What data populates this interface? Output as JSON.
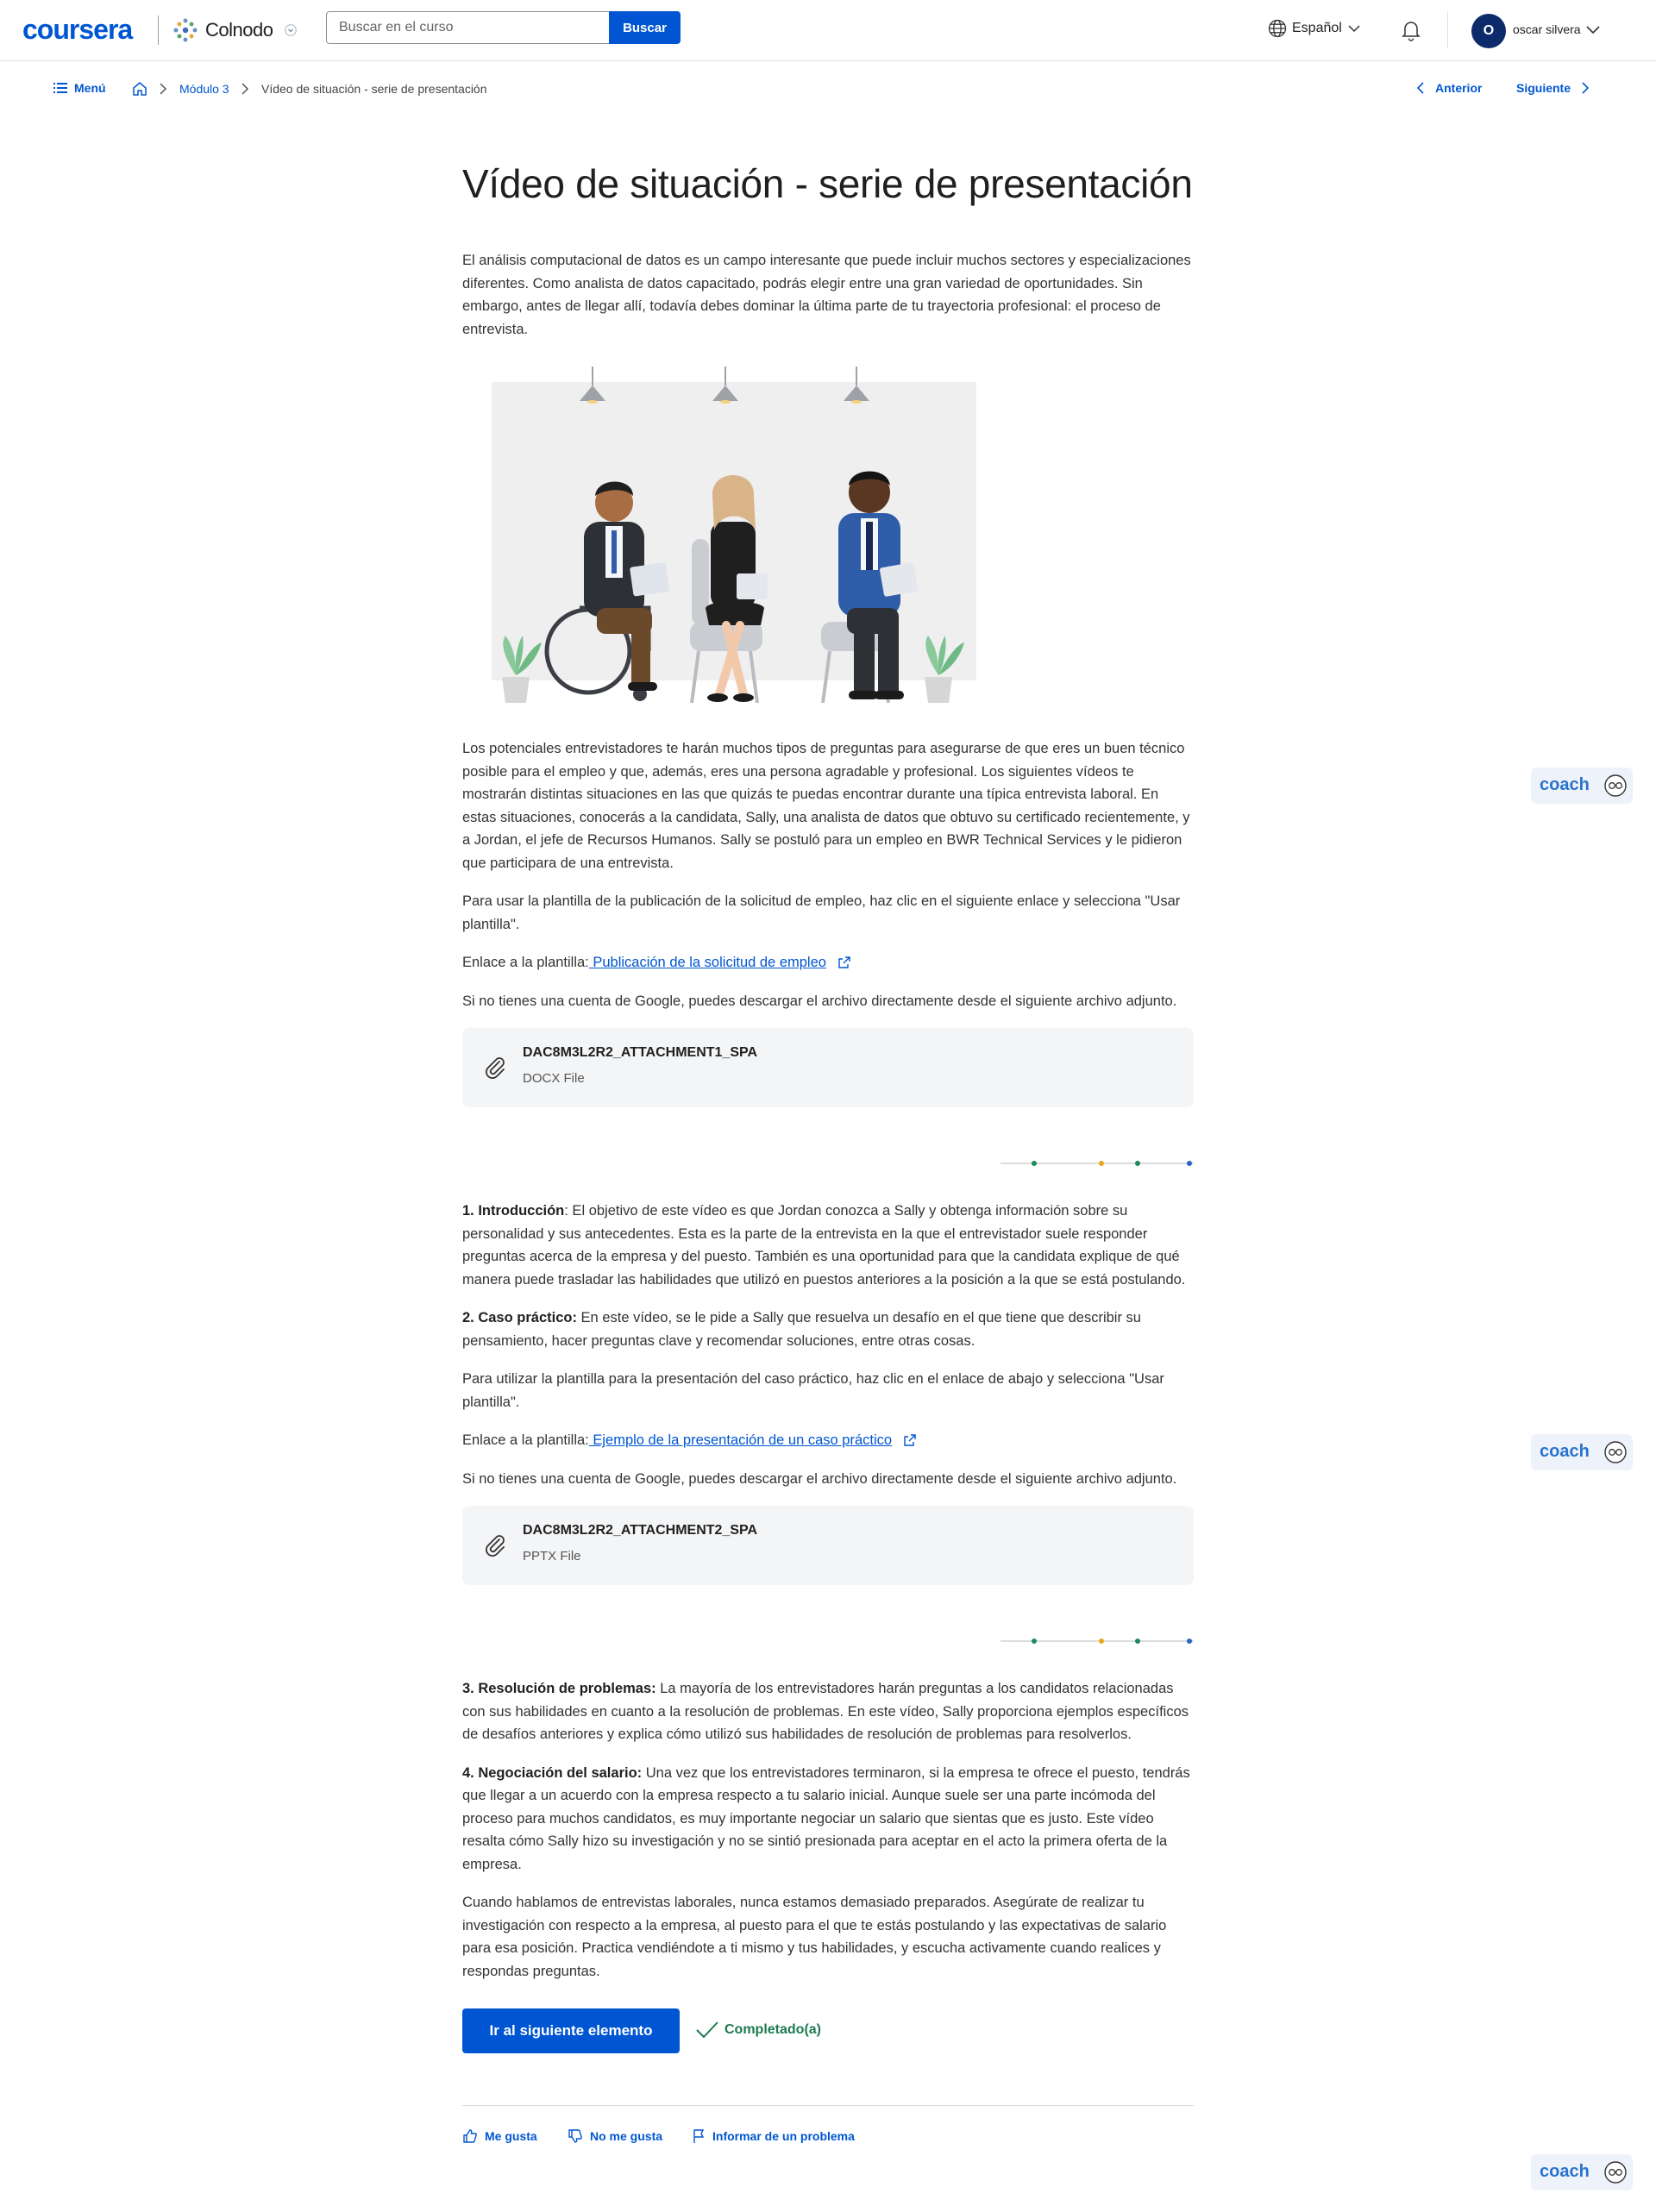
{
  "header": {
    "brand": "coursera",
    "partner": "Colnodo",
    "search_placeholder": "Buscar en el curso",
    "search_button": "Buscar",
    "language": "Español",
    "user_initial": "O",
    "user_name": "oscar silvera"
  },
  "subnav": {
    "menu": "Menú",
    "breadcrumb_module": "Módulo 3",
    "breadcrumb_current": "Vídeo de situación - serie de presentación",
    "prev": "Anterior",
    "next": "Siguiente"
  },
  "main": {
    "title": "Vídeo de situación - serie de presentación",
    "intro": "El análisis computacional de datos es un campo interesante que puede incluir muchos sectores y especializaciones diferentes. Como analista de datos capacitado, podrás elegir entre una gran variedad de oportunidades. Sin embargo, antes de llegar allí, todavía debes dominar la última parte de tu trayectoria profesional: el proceso de entrevista.",
    "para1": "Los potenciales entrevistadores te harán muchos tipos de preguntas para asegurarse de que eres un buen técnico posible para el empleo y que, además, eres una persona agradable y profesional. Los siguientes vídeos te mostrarán distintas situaciones en las que quizás te puedas encontrar durante una típica entrevista laboral. En estas situaciones, conocerás a la candidata, Sally, una analista de datos que obtuvo su certificado recientemente, y a Jordan, el jefe de Recursos Humanos. Sally se postuló para un empleo en BWR Technical Services y le pidieron que participara de una entrevista.",
    "para2": "Para usar la plantilla de la publicación de la solicitud de empleo, haz clic en el siguiente enlace y selecciona \"Usar plantilla\".",
    "link1_prefix": "Enlace a la plantilla:",
    "link1_text": " Publicación de la solicitud de empleo",
    "para3": "Si no tienes una cuenta de Google, puedes descargar el archivo directamente desde el siguiente archivo adjunto.",
    "attachment1": {
      "name": "DAC8M3L2R2_ATTACHMENT1_SPA",
      "type": "DOCX File"
    },
    "item1_label": "1. Introducción",
    "item1_text": ": El objetivo de este vídeo es que Jordan conozca a Sally y obtenga información sobre su personalidad y sus antecedentes. Esta es la parte de la entrevista en la que el entrevistador suele responder preguntas acerca de la empresa y del puesto. También es una oportunidad para que la candidata explique de qué manera puede trasladar las habilidades que utilizó en puestos anteriores a la posición a la que se está postulando.",
    "item2_label": "2. Caso práctico:",
    "item2_text": " En este vídeo, se le pide a Sally que resuelva un desafío en el que tiene que describir su pensamiento, hacer preguntas clave y recomendar soluciones, entre otras cosas.",
    "para4": "Para utilizar la plantilla para la presentación del caso práctico, haz clic en el enlace de abajo y selecciona \"Usar plantilla\".",
    "link2_prefix": "Enlace a la plantilla:",
    "link2_text": " Ejemplo de la presentación de un caso práctico",
    "para5": "Si no tienes una cuenta de Google, puedes descargar el archivo directamente desde el siguiente archivo adjunto.",
    "attachment2": {
      "name": "DAC8M3L2R2_ATTACHMENT2_SPA",
      "type": "PPTX File"
    },
    "item3_label": "3. Resolución de problemas:",
    "item3_text": " La mayoría de los entrevistadores harán preguntas a los candidatos relacionadas con sus habilidades en cuanto a la resolución de problemas. En este vídeo, Sally proporciona ejemplos específicos de desafíos anteriores y explica cómo utilizó sus habilidades de resolución de problemas para resolverlos.",
    "item4_label": "4. Negociación del salario:",
    "item4_text": " Una vez que los entrevistadores terminaron, si la empresa te ofrece el puesto, tendrás que llegar a un acuerdo con la empresa respecto a tu salario inicial. Aunque suele ser una parte incómoda del proceso para muchos candidatos, es muy importante negociar un salario que sientas que es justo. Este vídeo resalta cómo Sally hizo su investigación y no se sintió presionada para aceptar en el acto la primera oferta de la empresa.",
    "closing": "Cuando hablamos de entrevistas laborales, nunca estamos demasiado preparados. Asegúrate de realizar tu investigación con respecto a la empresa, al puesto para el que te estás postulando y las expectativas de salario para esa posición. Practica vendiéndote a ti mismo y tus habilidades, y escucha activamente cuando realices y respondas preguntas.",
    "next_item_button": "Ir al siguiente elemento",
    "completed": "Completado(a)"
  },
  "feedback": {
    "like": "Me gusta",
    "dislike": "No me gusta",
    "report": "Informar de un problema"
  },
  "coach": {
    "label": "coach"
  },
  "colors": {
    "accent": "#0056d2",
    "completed": "#1d7a4e",
    "avatar": "#0d2a6b"
  }
}
